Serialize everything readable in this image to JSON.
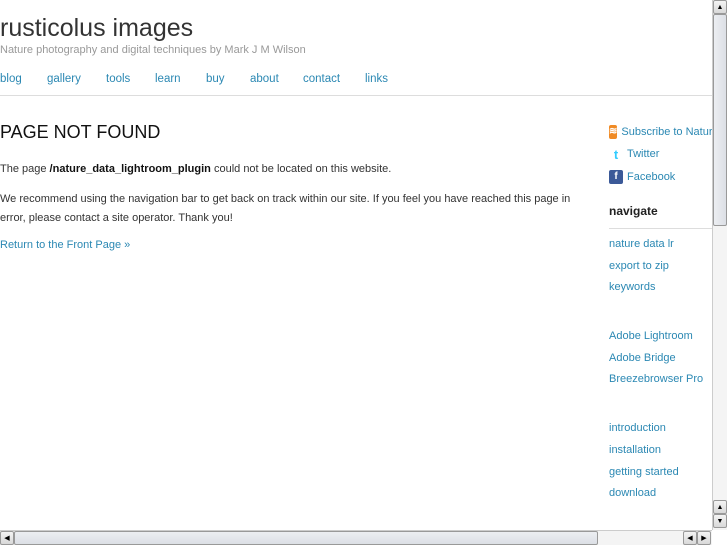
{
  "site": {
    "title": "rusticolus images",
    "tagline": "Nature photography and digital techniques by Mark J M Wilson"
  },
  "nav": [
    "blog",
    "gallery",
    "tools",
    "learn",
    "buy",
    "about",
    "contact",
    "links"
  ],
  "main": {
    "heading": "PAGE NOT FOUND",
    "p1_prefix": "The page ",
    "p1_path": "/nature_data_lightroom_plugin",
    "p1_suffix": " could not be located on this website.",
    "p2": "We recommend using the navigation bar to get back on track within our site. If you feel you have reached this page in error, please contact a site operator. Thank you!",
    "return_link": "Return to the Front Page »"
  },
  "sidebar": {
    "social": [
      {
        "icon": "rss-icon",
        "label": "Subscribe to Nature"
      },
      {
        "icon": "twitter-icon",
        "label": "Twitter"
      },
      {
        "icon": "facebook-icon",
        "label": "Facebook"
      }
    ],
    "navigate_heading": "navigate",
    "groups": [
      [
        "nature data lr",
        "export to zip",
        "keywords"
      ],
      [
        "Adobe Lightroom",
        "Adobe Bridge",
        "Breezebrowser Pro"
      ],
      [
        "introduction",
        "installation",
        "getting started",
        "download"
      ]
    ]
  },
  "colors": {
    "link": "#2b88b3",
    "rss": "#f08a24",
    "facebook": "#3b5998",
    "twitter": "#33ccff"
  }
}
